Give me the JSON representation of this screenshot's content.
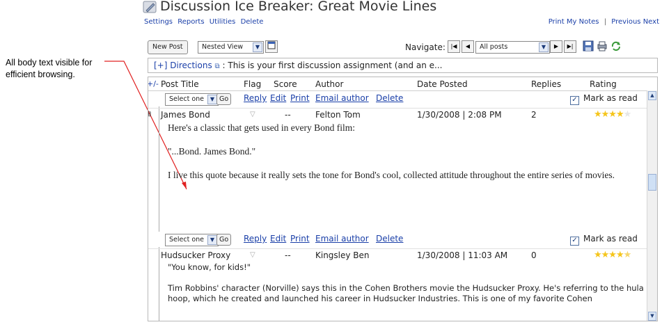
{
  "page": {
    "title": "Discussion Ice Breaker: Great Movie Lines",
    "menu": [
      "Settings",
      "Reports",
      "Utilities",
      "Delete"
    ],
    "right_menu": [
      "Print",
      "My Notes",
      "|",
      "Previous",
      "Next"
    ]
  },
  "callout": {
    "text": "All body text visible for efficient browsing."
  },
  "toolbar": {
    "new_post": "New Post",
    "view_select": "Nested View",
    "navigate_label": "Navigate:",
    "posts_select": "All posts"
  },
  "directions": {
    "toggle": "[+]",
    "label": "Directions",
    "text": ": This is your first discussion assignment (and an e..."
  },
  "grid": {
    "headers": {
      "toggle": "+/-",
      "post_title": "Post Title",
      "flag": "Flag",
      "score": "Score",
      "author": "Author",
      "date": "Date Posted",
      "replies": "Replies",
      "rating": "Rating"
    },
    "actions": {
      "select": "Select one",
      "go": "Go",
      "reply": "Reply",
      "edit": "Edit",
      "print": "Print",
      "email": "Email author",
      "delete": "Delete",
      "mark_read": "Mark as read"
    },
    "posts": [
      {
        "title": "James Bond",
        "flag": "▽",
        "score": "--",
        "author": "Felton Tom",
        "date": "1/30/2008 | 2:08 PM",
        "replies": "2",
        "rating_stars": 4,
        "body": [
          "Here's a classic that gets used in every Bond film:",
          "\"...Bond. James Bond.\"",
          "I live this quote because it really sets the tone for Bond's cool, collected attitude throughout the entire series of movies."
        ]
      },
      {
        "title": "Hudsucker Proxy",
        "flag": "▽",
        "score": "--",
        "author": "Kingsley Ben",
        "date": "1/30/2008 | 11:03 AM",
        "replies": "0",
        "rating_stars": 4.5,
        "body": [
          "\"You know, for kids!\"",
          "Tim Robbins' character (Norville) says this in the Cohen Brothers movie the Hudsucker Proxy. He's referring to the hula hoop, which he created and launched his career in Hudsucker Industries. This is one of my favorite Cohen"
        ]
      }
    ]
  },
  "colors": {
    "link": "#1a3fa8",
    "star": "#f5c51b",
    "callout_arrow": "#e02020"
  }
}
